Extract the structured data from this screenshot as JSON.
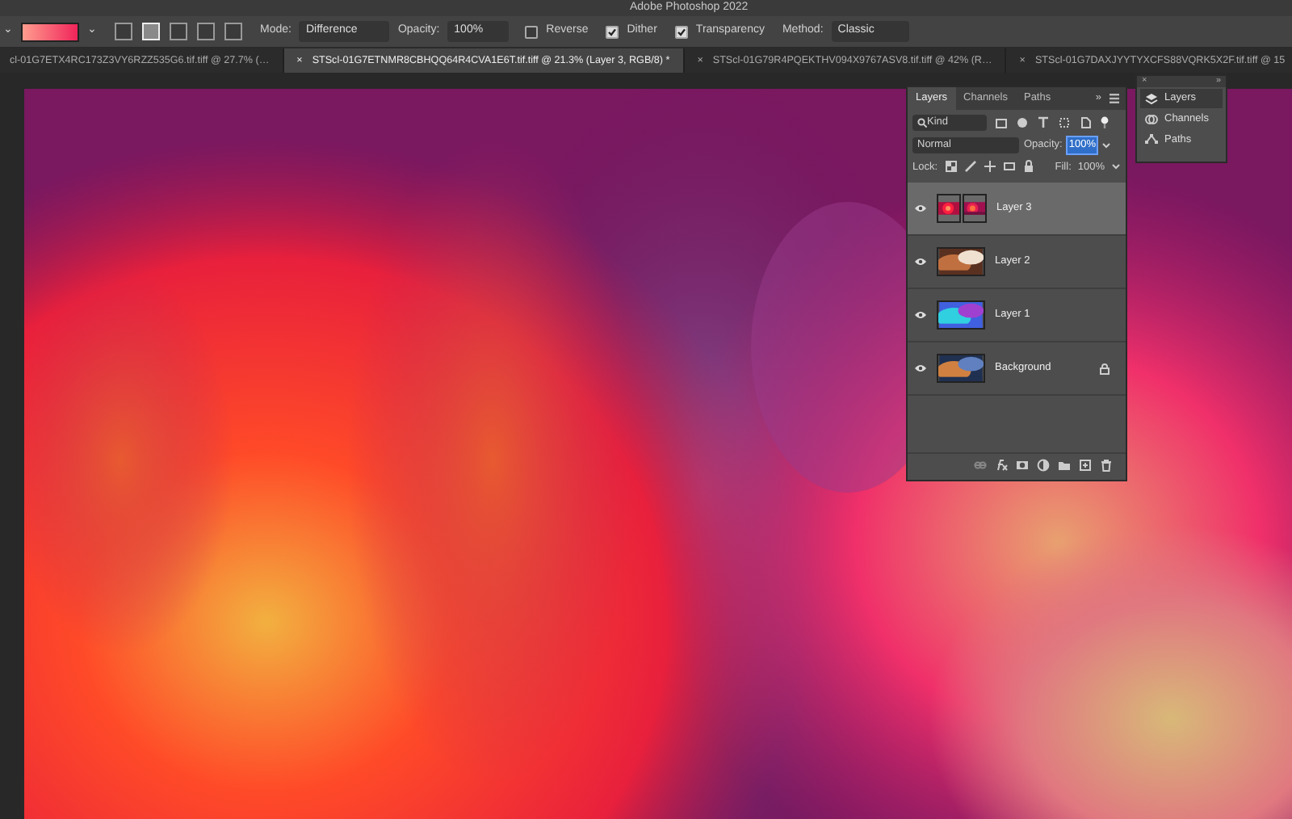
{
  "window": {
    "title": "Adobe Photoshop 2022"
  },
  "options_bar": {
    "preset_caret": "⌄",
    "swatch_caret": "⌄",
    "gradient_types": [
      {
        "selected": false
      },
      {
        "selected": true
      },
      {
        "selected": false
      },
      {
        "selected": false
      },
      {
        "selected": false
      }
    ],
    "mode": {
      "label": "Mode:",
      "value": "Difference"
    },
    "opacity": {
      "label": "Opacity:",
      "value": "100%"
    },
    "checkboxes": [
      {
        "label": "Reverse",
        "checked": false
      },
      {
        "label": "Dither",
        "checked": true
      },
      {
        "label": "Transparency",
        "checked": true
      }
    ],
    "method": {
      "label": "Method:",
      "value": "Classic"
    }
  },
  "document_tabs": [
    {
      "title": "cl-01G7ETX4RC173Z3VY6RZZ535G6.tif.tiff @ 27.7% (…",
      "selected": false
    },
    {
      "close": "×",
      "title": "STScl-01G7ETNMR8CBHQQ64R4CVA1E6T.tif.tiff @ 21.3% (Layer 3, RGB/8) *",
      "selected": true
    },
    {
      "close": "×",
      "title": "STScl-01G79R4PQEKTHV094X9767ASV8.tif.tiff @ 42% (R…",
      "selected": false
    },
    {
      "close": "×",
      "title": "STScl-01G7DAXJYYTYXCFS88VQRK5X2F.tif.tiff @ 15",
      "selected": false
    }
  ],
  "layers_panel": {
    "tabs": [
      {
        "label": "Layers",
        "selected": true
      },
      {
        "label": "Channels",
        "selected": false
      },
      {
        "label": "Paths",
        "selected": false
      }
    ],
    "collapse": "»",
    "filter": {
      "value": "Kind"
    },
    "blend_mode": "Normal",
    "opacity": {
      "label": "Opacity:",
      "value": "100%"
    },
    "lock_label": "Lock:",
    "fill": {
      "label": "Fill:",
      "value": "100%"
    },
    "layers": [
      {
        "name": "Layer 3",
        "selected": true,
        "visible": true,
        "locked": false,
        "has_mask": true
      },
      {
        "name": "Layer 2",
        "selected": false,
        "visible": true,
        "locked": false,
        "has_mask": false
      },
      {
        "name": "Layer 1",
        "selected": false,
        "visible": true,
        "locked": false,
        "has_mask": false
      },
      {
        "name": "Background",
        "selected": false,
        "visible": true,
        "locked": true,
        "has_mask": false
      }
    ]
  },
  "dock": {
    "close": "×",
    "collapse": "»",
    "items": [
      {
        "label": "Layers",
        "selected": true
      },
      {
        "label": "Channels",
        "selected": false
      },
      {
        "label": "Paths",
        "selected": false
      }
    ]
  }
}
